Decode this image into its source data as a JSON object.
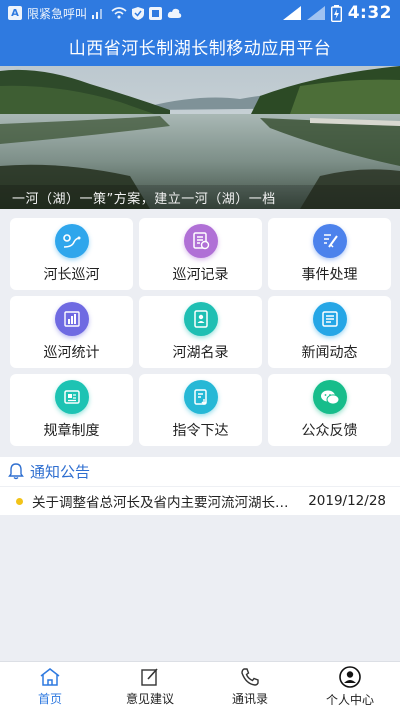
{
  "status_bar": {
    "carrier_text": "限紧急呼叫",
    "time": "4:32",
    "icons": [
      "sim-icon",
      "signal-icon",
      "wifi-icon",
      "shield-icon",
      "notification-icon",
      "cloud-icon",
      "battery-icon"
    ]
  },
  "header": {
    "title": "山西省河长制湖长制移动应用平台"
  },
  "banner": {
    "caption": "一河（湖）一策”方案，建立一河（湖）一档"
  },
  "menu": {
    "items": [
      {
        "label": "河长巡河",
        "icon": "patrol-route-icon",
        "color": "#2fa6ec"
      },
      {
        "label": "巡河记录",
        "icon": "record-icon",
        "color": "#b070d6"
      },
      {
        "label": "事件处理",
        "icon": "edit-check-icon",
        "color": "#4c82ec"
      },
      {
        "label": "巡河统计",
        "icon": "bar-chart-icon",
        "color": "#6f6ae2"
      },
      {
        "label": "河湖名录",
        "icon": "directory-icon",
        "color": "#1fbfb3"
      },
      {
        "label": "新闻动态",
        "icon": "news-icon",
        "color": "#25a6e6"
      },
      {
        "label": "规章制度",
        "icon": "regulation-icon",
        "color": "#1dc3b3"
      },
      {
        "label": "指令下达",
        "icon": "instruction-icon",
        "color": "#26b8d6"
      },
      {
        "label": "公众反馈",
        "icon": "wechat-icon",
        "color": "#17bd8b"
      }
    ]
  },
  "notice": {
    "title": "通知公告",
    "items": [
      {
        "text": "关于调整省总河长及省内主要河流河湖长的通知",
        "date": "2019/12/28"
      }
    ]
  },
  "bottom_nav": {
    "items": [
      {
        "label": "首页",
        "icon": "home-icon",
        "active": true
      },
      {
        "label": "意见建议",
        "icon": "edit-icon",
        "active": false
      },
      {
        "label": "通讯录",
        "icon": "phone-icon",
        "active": false
      },
      {
        "label": "个人中心",
        "icon": "user-icon",
        "active": false
      }
    ]
  },
  "colors": {
    "primary": "#2f7ae0",
    "notice_dot": "#f2c318",
    "notice_title": "#2f6fd0"
  }
}
